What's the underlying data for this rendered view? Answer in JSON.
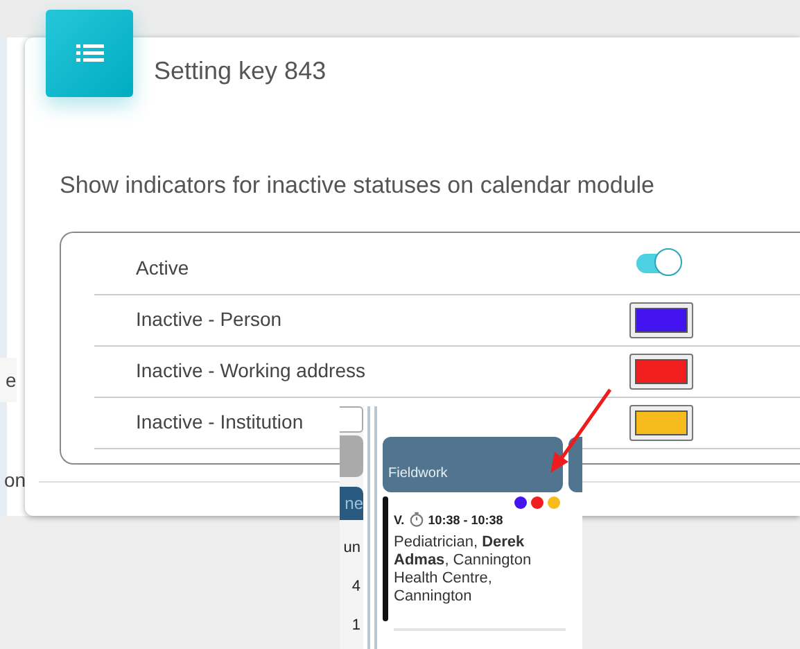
{
  "background": {
    "fragments": [
      "e",
      "on"
    ]
  },
  "dialog": {
    "title": "Setting key 843",
    "description": "Show indicators for inactive statuses on calendar module",
    "rows": [
      {
        "label": "Active",
        "kind": "toggle",
        "on": true
      },
      {
        "label": "Inactive - Person",
        "kind": "color",
        "color": "#4414f0"
      },
      {
        "label": "Inactive - Working address",
        "kind": "color",
        "color": "#f01e1e"
      },
      {
        "label": "Inactive - Institution",
        "kind": "color",
        "color": "#f8bb1c"
      }
    ]
  },
  "inset": {
    "side_texts": [
      "ne",
      "un",
      "4",
      "1"
    ],
    "event": {
      "title": "Fieldwork",
      "dots": [
        {
          "color": "#4414f0"
        },
        {
          "color": "#f01e1e"
        },
        {
          "color": "#f8bb1c"
        }
      ],
      "time_prefix": "V.",
      "time": "10:38 - 10:38",
      "details": "Pediatrician, **Derek Admas**, Cannington Health Centre, Cannington"
    }
  }
}
